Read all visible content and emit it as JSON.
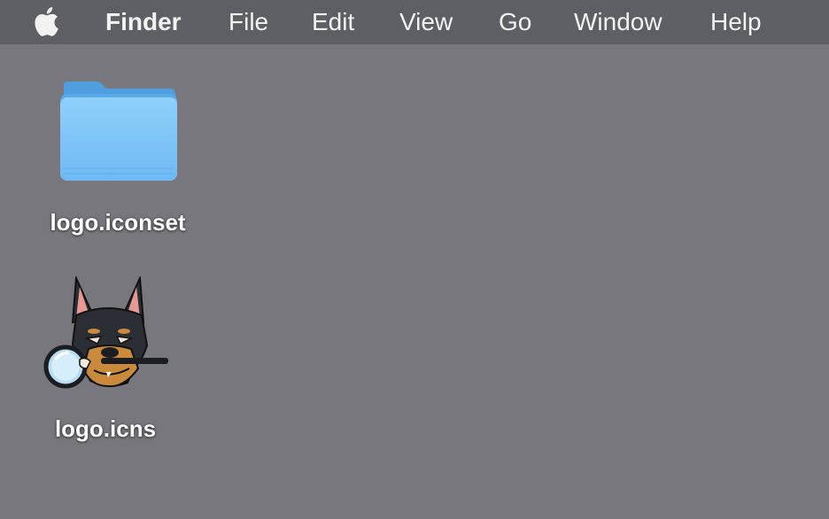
{
  "menubar": {
    "apple_icon": "apple-logo-icon",
    "app_name": "Finder",
    "items": [
      "File",
      "Edit",
      "View",
      "Go",
      "Window",
      "Help"
    ]
  },
  "desktop": {
    "icons": [
      {
        "label": "logo.iconset",
        "icon": "folder-icon",
        "color": "#7cc4f7"
      },
      {
        "label": "logo.icns",
        "icon": "doberman-magnifier-icon"
      }
    ]
  },
  "colors": {
    "desktop_bg": "#77777d",
    "menubar_bg": "#5e5f64"
  }
}
